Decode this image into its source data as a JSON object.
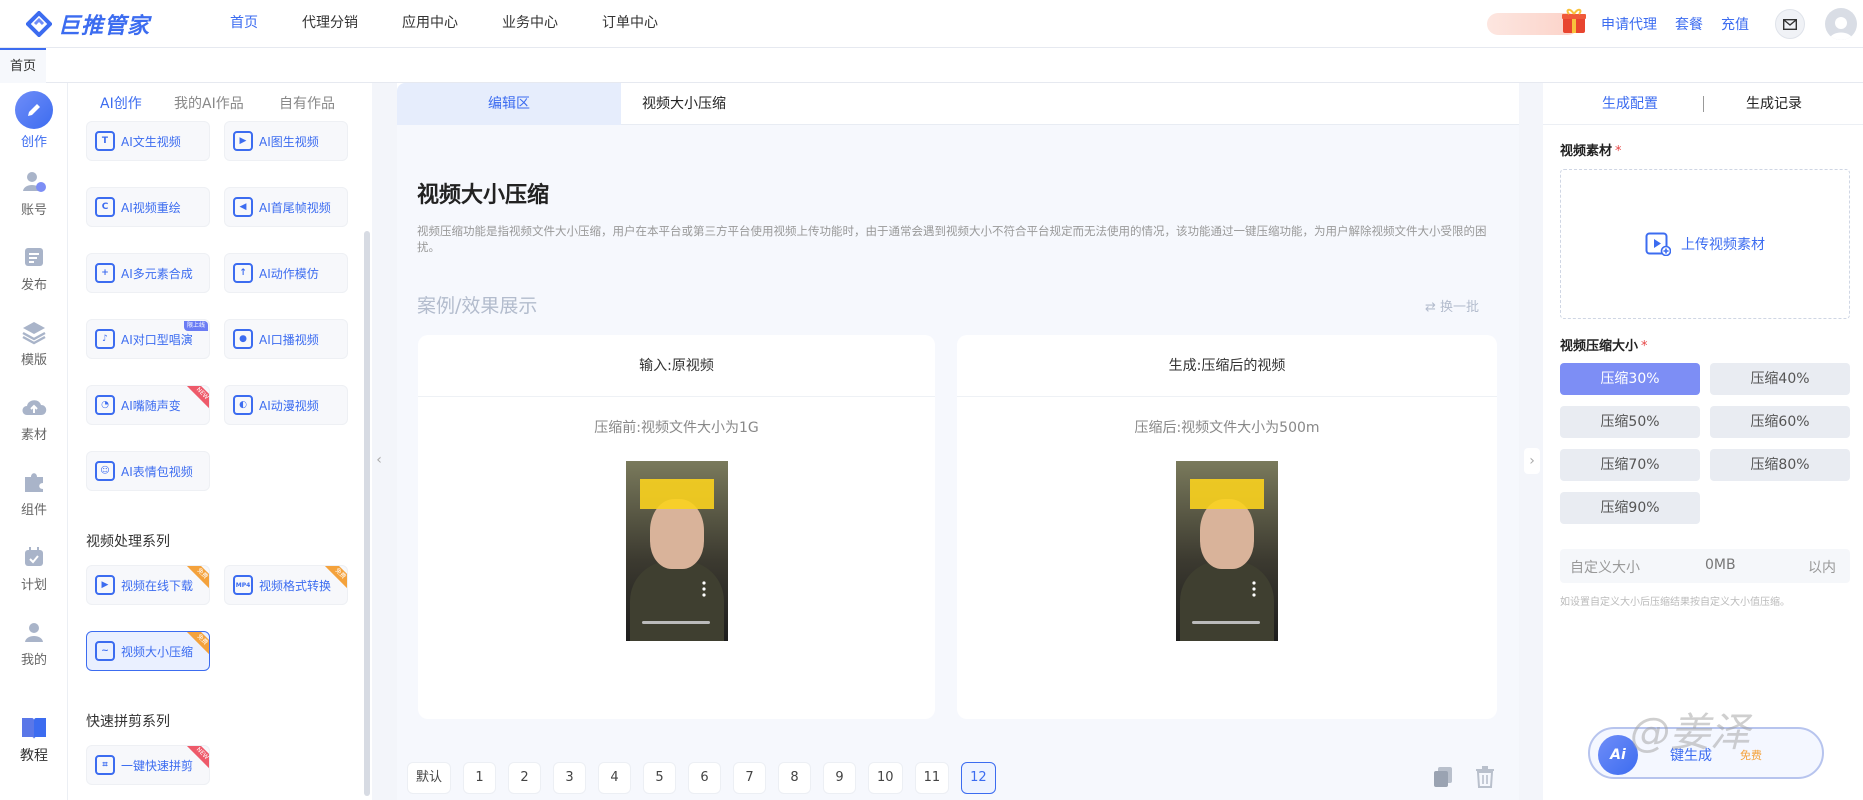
{
  "brand": {
    "name": "巨推管家",
    "accent": "#3c6cf0"
  },
  "top_nav": {
    "items": [
      "首页",
      "代理分销",
      "应用中心",
      "业务中心",
      "订单中心"
    ],
    "right_links": [
      "申请代理",
      "套餐",
      "充值"
    ]
  },
  "page_tabs": [
    "首页"
  ],
  "rail": [
    "创作",
    "账号",
    "发布",
    "模版",
    "素材",
    "组件",
    "计划",
    "我的",
    "教程"
  ],
  "tool_panel": {
    "tabs": [
      "AI创作",
      "我的AI作品",
      "自有作品"
    ],
    "tools": [
      {
        "label": "AI文生视频"
      },
      {
        "label": "AI图生视频"
      },
      {
        "label": "AI视频重绘"
      },
      {
        "label": "AI首尾帧视频"
      },
      {
        "label": "AI多元素合成"
      },
      {
        "label": "AI动作模仿"
      },
      {
        "label": "AI对口型唱演",
        "badge": "限上线"
      },
      {
        "label": "AI口播视频"
      },
      {
        "label": "AI嘴随声变",
        "badge": "NEW"
      },
      {
        "label": "AI动漫视频"
      },
      {
        "label": "AI表情包视频"
      }
    ],
    "section_video": "视频处理系列",
    "video_tools": [
      {
        "label": "视频在线下载",
        "badge": "免费"
      },
      {
        "label": "视频格式转换",
        "badge": "免费",
        "icon_text": "MP4"
      },
      {
        "label": "视频大小压缩",
        "badge": "免费"
      }
    ],
    "section_quick": "快速拼剪系列",
    "quick_tools": [
      {
        "label": "一键快速拼剪",
        "badge": "NEW"
      }
    ]
  },
  "editor": {
    "tab_active": "编辑区",
    "tab_file": "视频大小压缩",
    "title": "视频大小压缩",
    "description": "视频压缩功能是指视频文件大小压缩，用户在本平台或第三方平台使用视频上传功能时，由于通常会遇到视频大小不符合平台规定而无法使用的情况，该功能通过一键压缩功能，为用户解除视频文件大小受限的困扰。",
    "case_title": "案例/效果展示",
    "refresh_label": "换一批",
    "input_card": {
      "head": "输入:原视频",
      "sub": "压缩前:视频文件大小为1G"
    },
    "output_card": {
      "head": "生成:压缩后的视频",
      "sub": "压缩后:视频文件大小为500m"
    },
    "pager": [
      "默认",
      "1",
      "2",
      "3",
      "4",
      "5",
      "6",
      "7",
      "8",
      "9",
      "10",
      "11",
      "12"
    ],
    "pager_active": "12"
  },
  "right_panel": {
    "tabs": [
      "生成配置",
      "生成记录"
    ],
    "material_label": "视频素材",
    "upload_label": "上传视频素材",
    "compress_label": "视频压缩大小",
    "options": [
      "压缩30%",
      "压缩40%",
      "压缩50%",
      "压缩60%",
      "压缩70%",
      "压缩80%",
      "压缩90%"
    ],
    "selected_option": "压缩30%",
    "custom_label": "自定义大小",
    "custom_value": "0MB",
    "custom_suffix": "以内",
    "custom_hint": "如设置自定义大小后压缩结果按自定义大小值压缩。",
    "generate_label": "键生成",
    "generate_sub": "免费"
  },
  "watermark": "@姜泽"
}
